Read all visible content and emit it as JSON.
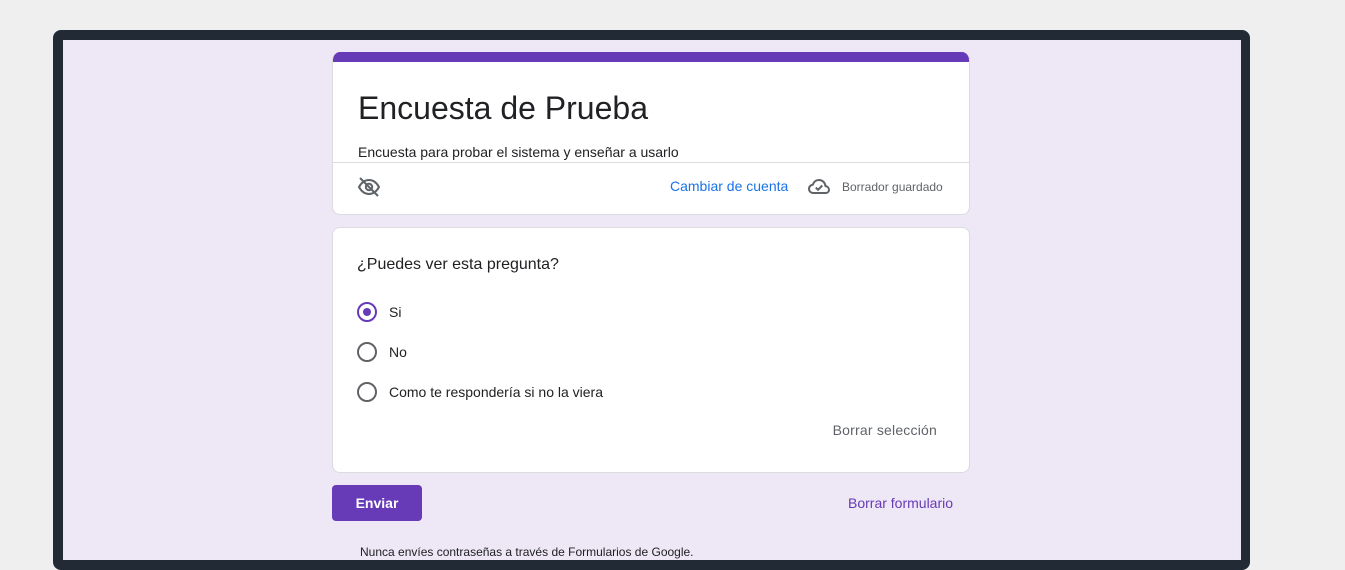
{
  "form": {
    "title": "Encuesta de Prueba",
    "description": "Encuesta para probar el sistema y enseñar a usarlo",
    "switch_account": "Cambiar de cuenta",
    "draft_status": "Borrador guardado",
    "accent_color": "#673ab7"
  },
  "question": {
    "title": "¿Puedes ver esta pregunta?",
    "options": [
      {
        "label": "Si",
        "selected": true
      },
      {
        "label": "No",
        "selected": false
      },
      {
        "label": "Como te respondería si no la viera",
        "selected": false
      }
    ],
    "clear_selection": "Borrar selección"
  },
  "actions": {
    "submit": "Enviar",
    "clear_form": "Borrar formulario"
  },
  "footer": {
    "text": "Nunca envíes contraseñas a través de Formularios de Google."
  },
  "icons": {
    "visibility": "eye-off-icon",
    "draft": "cloud-check-icon"
  }
}
